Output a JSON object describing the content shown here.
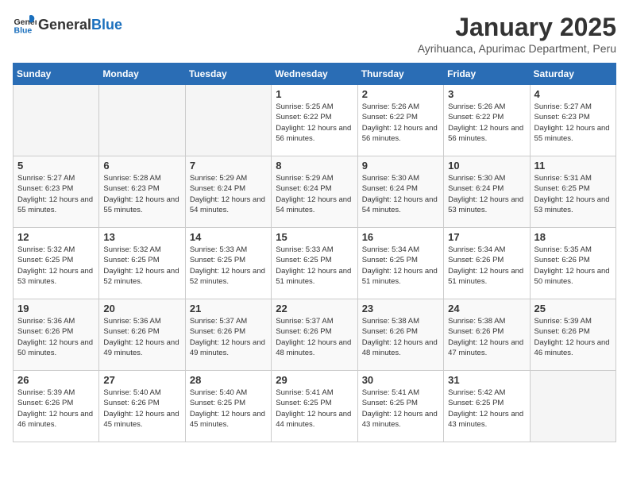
{
  "header": {
    "logo_general": "General",
    "logo_blue": "Blue",
    "title": "January 2025",
    "subtitle": "Ayrihuanca, Apurimac Department, Peru"
  },
  "days_of_week": [
    "Sunday",
    "Monday",
    "Tuesday",
    "Wednesday",
    "Thursday",
    "Friday",
    "Saturday"
  ],
  "weeks": [
    [
      {
        "day": "",
        "empty": true
      },
      {
        "day": "",
        "empty": true
      },
      {
        "day": "",
        "empty": true
      },
      {
        "day": "1",
        "sunrise": "5:25 AM",
        "sunset": "6:22 PM",
        "daylight": "12 hours and 56 minutes."
      },
      {
        "day": "2",
        "sunrise": "5:26 AM",
        "sunset": "6:22 PM",
        "daylight": "12 hours and 56 minutes."
      },
      {
        "day": "3",
        "sunrise": "5:26 AM",
        "sunset": "6:22 PM",
        "daylight": "12 hours and 56 minutes."
      },
      {
        "day": "4",
        "sunrise": "5:27 AM",
        "sunset": "6:23 PM",
        "daylight": "12 hours and 55 minutes."
      }
    ],
    [
      {
        "day": "5",
        "sunrise": "5:27 AM",
        "sunset": "6:23 PM",
        "daylight": "12 hours and 55 minutes."
      },
      {
        "day": "6",
        "sunrise": "5:28 AM",
        "sunset": "6:23 PM",
        "daylight": "12 hours and 55 minutes."
      },
      {
        "day": "7",
        "sunrise": "5:29 AM",
        "sunset": "6:24 PM",
        "daylight": "12 hours and 54 minutes."
      },
      {
        "day": "8",
        "sunrise": "5:29 AM",
        "sunset": "6:24 PM",
        "daylight": "12 hours and 54 minutes."
      },
      {
        "day": "9",
        "sunrise": "5:30 AM",
        "sunset": "6:24 PM",
        "daylight": "12 hours and 54 minutes."
      },
      {
        "day": "10",
        "sunrise": "5:30 AM",
        "sunset": "6:24 PM",
        "daylight": "12 hours and 53 minutes."
      },
      {
        "day": "11",
        "sunrise": "5:31 AM",
        "sunset": "6:25 PM",
        "daylight": "12 hours and 53 minutes."
      }
    ],
    [
      {
        "day": "12",
        "sunrise": "5:32 AM",
        "sunset": "6:25 PM",
        "daylight": "12 hours and 53 minutes."
      },
      {
        "day": "13",
        "sunrise": "5:32 AM",
        "sunset": "6:25 PM",
        "daylight": "12 hours and 52 minutes."
      },
      {
        "day": "14",
        "sunrise": "5:33 AM",
        "sunset": "6:25 PM",
        "daylight": "12 hours and 52 minutes."
      },
      {
        "day": "15",
        "sunrise": "5:33 AM",
        "sunset": "6:25 PM",
        "daylight": "12 hours and 51 minutes."
      },
      {
        "day": "16",
        "sunrise": "5:34 AM",
        "sunset": "6:25 PM",
        "daylight": "12 hours and 51 minutes."
      },
      {
        "day": "17",
        "sunrise": "5:34 AM",
        "sunset": "6:26 PM",
        "daylight": "12 hours and 51 minutes."
      },
      {
        "day": "18",
        "sunrise": "5:35 AM",
        "sunset": "6:26 PM",
        "daylight": "12 hours and 50 minutes."
      }
    ],
    [
      {
        "day": "19",
        "sunrise": "5:36 AM",
        "sunset": "6:26 PM",
        "daylight": "12 hours and 50 minutes."
      },
      {
        "day": "20",
        "sunrise": "5:36 AM",
        "sunset": "6:26 PM",
        "daylight": "12 hours and 49 minutes."
      },
      {
        "day": "21",
        "sunrise": "5:37 AM",
        "sunset": "6:26 PM",
        "daylight": "12 hours and 49 minutes."
      },
      {
        "day": "22",
        "sunrise": "5:37 AM",
        "sunset": "6:26 PM",
        "daylight": "12 hours and 48 minutes."
      },
      {
        "day": "23",
        "sunrise": "5:38 AM",
        "sunset": "6:26 PM",
        "daylight": "12 hours and 48 minutes."
      },
      {
        "day": "24",
        "sunrise": "5:38 AM",
        "sunset": "6:26 PM",
        "daylight": "12 hours and 47 minutes."
      },
      {
        "day": "25",
        "sunrise": "5:39 AM",
        "sunset": "6:26 PM",
        "daylight": "12 hours and 46 minutes."
      }
    ],
    [
      {
        "day": "26",
        "sunrise": "5:39 AM",
        "sunset": "6:26 PM",
        "daylight": "12 hours and 46 minutes."
      },
      {
        "day": "27",
        "sunrise": "5:40 AM",
        "sunset": "6:26 PM",
        "daylight": "12 hours and 45 minutes."
      },
      {
        "day": "28",
        "sunrise": "5:40 AM",
        "sunset": "6:25 PM",
        "daylight": "12 hours and 45 minutes."
      },
      {
        "day": "29",
        "sunrise": "5:41 AM",
        "sunset": "6:25 PM",
        "daylight": "12 hours and 44 minutes."
      },
      {
        "day": "30",
        "sunrise": "5:41 AM",
        "sunset": "6:25 PM",
        "daylight": "12 hours and 43 minutes."
      },
      {
        "day": "31",
        "sunrise": "5:42 AM",
        "sunset": "6:25 PM",
        "daylight": "12 hours and 43 minutes."
      },
      {
        "day": "",
        "empty": true
      }
    ]
  ],
  "labels": {
    "sunrise_prefix": "Sunrise: ",
    "sunset_prefix": "Sunset: ",
    "daylight_prefix": "Daylight: "
  }
}
